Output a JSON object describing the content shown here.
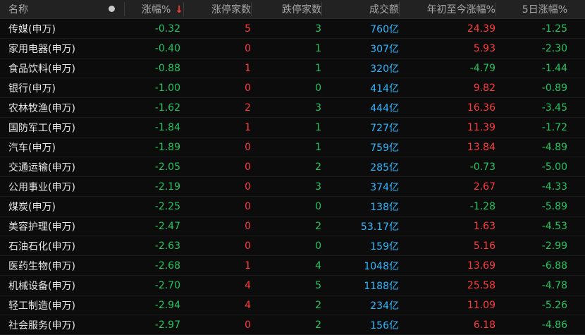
{
  "header": {
    "name": "名称",
    "change": "涨幅%",
    "sort_arrow": "↓",
    "limit_up": "涨停家数",
    "limit_down": "跌停家数",
    "amount": "成交额",
    "ytd": "年初至今涨幅%",
    "five_day": "5日涨幅%"
  },
  "colors": {
    "up": "#ff3b3b",
    "down": "#22c55e",
    "amount": "#2fb7ff",
    "background": "#0c0c0c"
  },
  "rows": [
    {
      "name": "传媒(申万)",
      "change": "-0.32",
      "limit_up": "5",
      "limit_down": "3",
      "amount": "760亿",
      "ytd": "24.39",
      "five_day": "-1.25"
    },
    {
      "name": "家用电器(申万)",
      "change": "-0.40",
      "limit_up": "0",
      "limit_down": "1",
      "amount": "307亿",
      "ytd": "5.93",
      "five_day": "-2.30"
    },
    {
      "name": "食品饮料(申万)",
      "change": "-0.88",
      "limit_up": "1",
      "limit_down": "1",
      "amount": "320亿",
      "ytd": "-4.79",
      "five_day": "-1.44"
    },
    {
      "name": "银行(申万)",
      "change": "-1.00",
      "limit_up": "0",
      "limit_down": "0",
      "amount": "414亿",
      "ytd": "9.82",
      "five_day": "-0.89"
    },
    {
      "name": "农林牧渔(申万)",
      "change": "-1.62",
      "limit_up": "2",
      "limit_down": "3",
      "amount": "444亿",
      "ytd": "16.36",
      "five_day": "-3.45"
    },
    {
      "name": "国防军工(申万)",
      "change": "-1.84",
      "limit_up": "1",
      "limit_down": "1",
      "amount": "727亿",
      "ytd": "11.39",
      "five_day": "-1.72"
    },
    {
      "name": "汽车(申万)",
      "change": "-1.89",
      "limit_up": "0",
      "limit_down": "1",
      "amount": "759亿",
      "ytd": "13.84",
      "five_day": "-4.89"
    },
    {
      "name": "交通运输(申万)",
      "change": "-2.05",
      "limit_up": "0",
      "limit_down": "2",
      "amount": "285亿",
      "ytd": "-0.73",
      "five_day": "-5.00"
    },
    {
      "name": "公用事业(申万)",
      "change": "-2.19",
      "limit_up": "0",
      "limit_down": "3",
      "amount": "374亿",
      "ytd": "2.67",
      "five_day": "-4.33"
    },
    {
      "name": "煤炭(申万)",
      "change": "-2.25",
      "limit_up": "0",
      "limit_down": "0",
      "amount": "138亿",
      "ytd": "-1.28",
      "five_day": "-5.89"
    },
    {
      "name": "美容护理(申万)",
      "change": "-2.47",
      "limit_up": "0",
      "limit_down": "2",
      "amount": "53.17亿",
      "ytd": "1.63",
      "five_day": "-4.53"
    },
    {
      "name": "石油石化(申万)",
      "change": "-2.63",
      "limit_up": "0",
      "limit_down": "0",
      "amount": "159亿",
      "ytd": "5.16",
      "five_day": "-2.99"
    },
    {
      "name": "医药生物(申万)",
      "change": "-2.68",
      "limit_up": "1",
      "limit_down": "4",
      "amount": "1048亿",
      "ytd": "13.69",
      "five_day": "-6.88"
    },
    {
      "name": "机械设备(申万)",
      "change": "-2.70",
      "limit_up": "4",
      "limit_down": "5",
      "amount": "1188亿",
      "ytd": "25.58",
      "five_day": "-4.78"
    },
    {
      "name": "轻工制造(申万)",
      "change": "-2.94",
      "limit_up": "4",
      "limit_down": "2",
      "amount": "234亿",
      "ytd": "11.09",
      "five_day": "-5.26"
    },
    {
      "name": "社会服务(申万)",
      "change": "-2.97",
      "limit_up": "0",
      "limit_down": "2",
      "amount": "156亿",
      "ytd": "6.18",
      "five_day": "-4.86"
    }
  ]
}
